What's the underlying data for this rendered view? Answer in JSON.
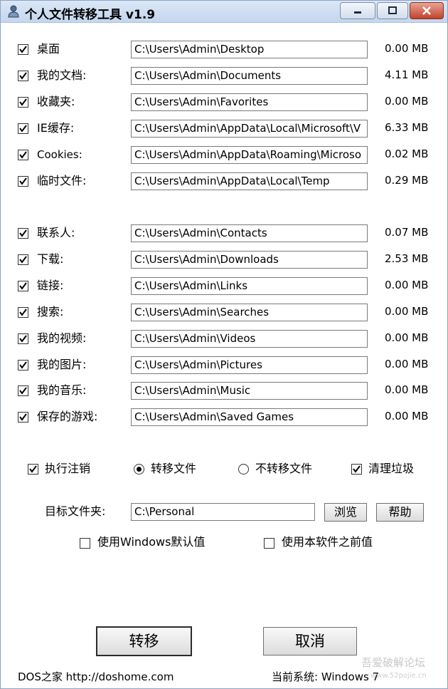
{
  "window": {
    "title": "个人文件转移工具 v1.9"
  },
  "group1": [
    {
      "label": "桌面",
      "path": "C:\\Users\\Admin\\Desktop",
      "size": "0.00 MB",
      "checked": true
    },
    {
      "label": "我的文档:",
      "path": "C:\\Users\\Admin\\Documents",
      "size": "4.11 MB",
      "checked": true
    },
    {
      "label": "收藏夹:",
      "path": "C:\\Users\\Admin\\Favorites",
      "size": "0.00 MB",
      "checked": true
    },
    {
      "label": "IE缓存:",
      "path": "C:\\Users\\Admin\\AppData\\Local\\Microsoft\\V",
      "size": "6.33 MB",
      "checked": true
    },
    {
      "label": "Cookies:",
      "path": "C:\\Users\\Admin\\AppData\\Roaming\\Microso",
      "size": "0.02 MB",
      "checked": true
    },
    {
      "label": "临时文件:",
      "path": "C:\\Users\\Admin\\AppData\\Local\\Temp",
      "size": "0.29 MB",
      "checked": true
    }
  ],
  "group2": [
    {
      "label": "联系人:",
      "path": "C:\\Users\\Admin\\Contacts",
      "size": "0.07 MB",
      "checked": true
    },
    {
      "label": "下载:",
      "path": "C:\\Users\\Admin\\Downloads",
      "size": "2.53 MB",
      "checked": true
    },
    {
      "label": "链接:",
      "path": "C:\\Users\\Admin\\Links",
      "size": "0.00 MB",
      "checked": true
    },
    {
      "label": "搜索:",
      "path": "C:\\Users\\Admin\\Searches",
      "size": "0.00 MB",
      "checked": true
    },
    {
      "label": "我的视频:",
      "path": "C:\\Users\\Admin\\Videos",
      "size": "0.00 MB",
      "checked": true
    },
    {
      "label": "我的图片:",
      "path": "C:\\Users\\Admin\\Pictures",
      "size": "0.00 MB",
      "checked": true
    },
    {
      "label": "我的音乐:",
      "path": "C:\\Users\\Admin\\Music",
      "size": "0.00 MB",
      "checked": true
    },
    {
      "label": "保存的游戏:",
      "path": "C:\\Users\\Admin\\Saved Games",
      "size": "0.00 MB",
      "checked": true
    }
  ],
  "options": {
    "logoff_label": "执行注销",
    "logoff_checked": true,
    "move_label": "转移文件",
    "move_selected": true,
    "nomove_label": "不转移文件",
    "nomove_selected": false,
    "clean_label": "清理垃圾",
    "clean_checked": true
  },
  "target": {
    "label": "目标文件夹:",
    "value": "C:\\Personal",
    "browse_label": "浏览",
    "help_label": "帮助"
  },
  "defaults": {
    "windows_default_label": "使用Windows默认值",
    "windows_default_checked": false,
    "previous_label": "使用本软件之前值",
    "previous_checked": false
  },
  "actions": {
    "transfer_label": "转移",
    "cancel_label": "取消"
  },
  "footer": {
    "left": "DOS之家 http://doshome.com",
    "system": "当前系统: Windows 7"
  },
  "watermark": {
    "text": "吾爱破解论坛",
    "url": "www.52pojie.cn"
  },
  "colors": {
    "title_gradient_top": "#dbe7f6",
    "close_button": "#c0432c"
  }
}
